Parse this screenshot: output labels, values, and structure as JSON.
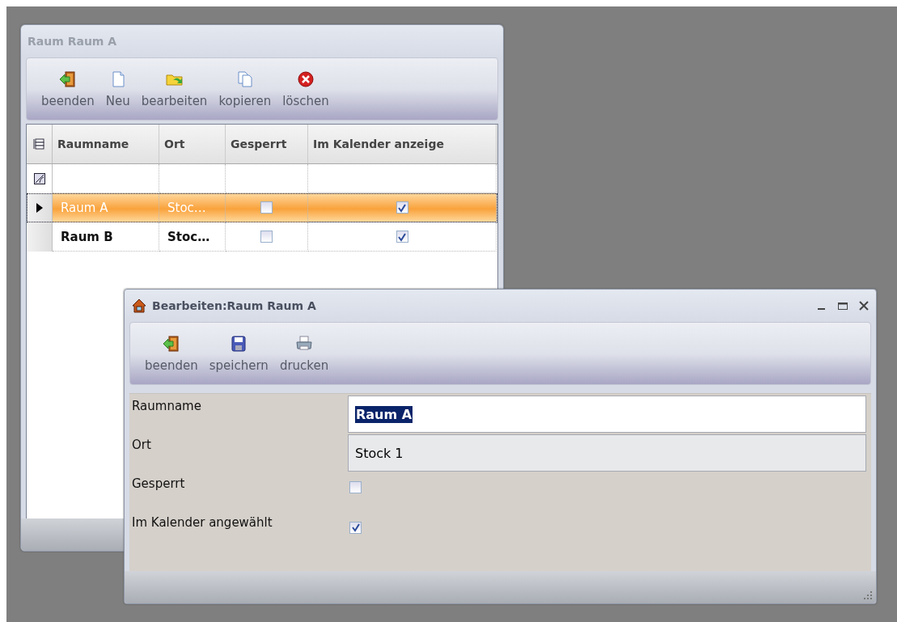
{
  "list_window": {
    "title": "Raum Raum A",
    "toolbar": [
      {
        "kind": "exit",
        "label": "beenden"
      },
      {
        "kind": "new",
        "label": "Neu"
      },
      {
        "kind": "edit",
        "label": "bearbeiten"
      },
      {
        "kind": "copy",
        "label": "kopieren"
      },
      {
        "kind": "delete",
        "label": "löschen"
      }
    ],
    "table": {
      "columns": [
        "Raumname",
        "Ort",
        "Gesperrt",
        "Im Kalender anzeige"
      ],
      "rows": [
        {
          "raumname": "Raum A",
          "ort": "Stoc…",
          "gesperrt": false,
          "im_kalender": true,
          "selected": true
        },
        {
          "raumname": "Raum B",
          "ort": "Stoc…",
          "gesperrt": false,
          "im_kalender": true,
          "selected": false
        }
      ]
    }
  },
  "edit_window": {
    "title": "Bearbeiten:Raum Raum A",
    "toolbar": [
      {
        "kind": "exit",
        "label": "beenden"
      },
      {
        "kind": "save",
        "label": "speichern"
      },
      {
        "kind": "print",
        "label": "drucken"
      }
    ],
    "fields": [
      {
        "kind": "text",
        "label": "Raumname",
        "value": "Raum A",
        "focused": true
      },
      {
        "kind": "text",
        "label": "Ort",
        "value": "Stock 1",
        "focused": false
      },
      {
        "kind": "checkbox",
        "label": "Gesperrt",
        "checked": false
      },
      {
        "kind": "checkbox",
        "label": "Im Kalender angewählt",
        "checked": true
      }
    ]
  }
}
